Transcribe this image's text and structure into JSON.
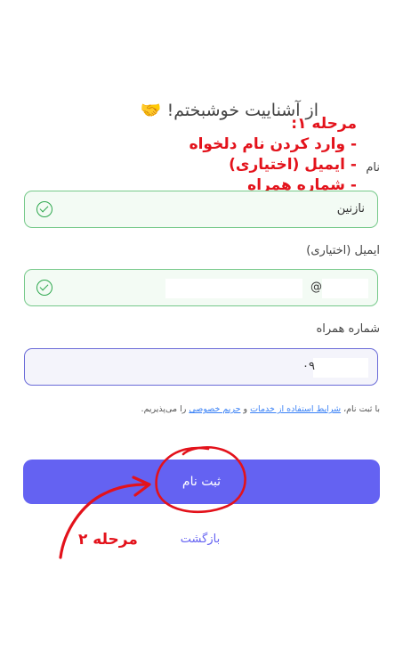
{
  "header": {
    "welcome_text": "از آشناییت خوشبختم!",
    "emoji": "🤝"
  },
  "annotation_step1": {
    "title": "مرحله ۱:",
    "lines": [
      "- وارد کردن نام دلخواه",
      "- ایمیل (اختیاری)",
      "- شماره همراه"
    ]
  },
  "form": {
    "name": {
      "label": "نام",
      "value": "نازنین"
    },
    "email": {
      "label": "ایمیل (اختیاری)",
      "value": "@"
    },
    "phone": {
      "label": "شماره همراه",
      "value": "۰۹"
    }
  },
  "terms": {
    "prefix": "با ثبت نام،",
    "terms_link": "شرایط استفاده از خدمات",
    "and": "و",
    "privacy_link": "حریم خصوصی",
    "suffix": "را می‌پذیریم."
  },
  "actions": {
    "submit_label": "ثبت نام",
    "back_label": "بازگشت"
  },
  "annotation_step2": {
    "label": "مرحله ۲"
  },
  "colors": {
    "accent": "#6462f2",
    "annotation": "#e3121b",
    "success": "#2fa84f"
  }
}
